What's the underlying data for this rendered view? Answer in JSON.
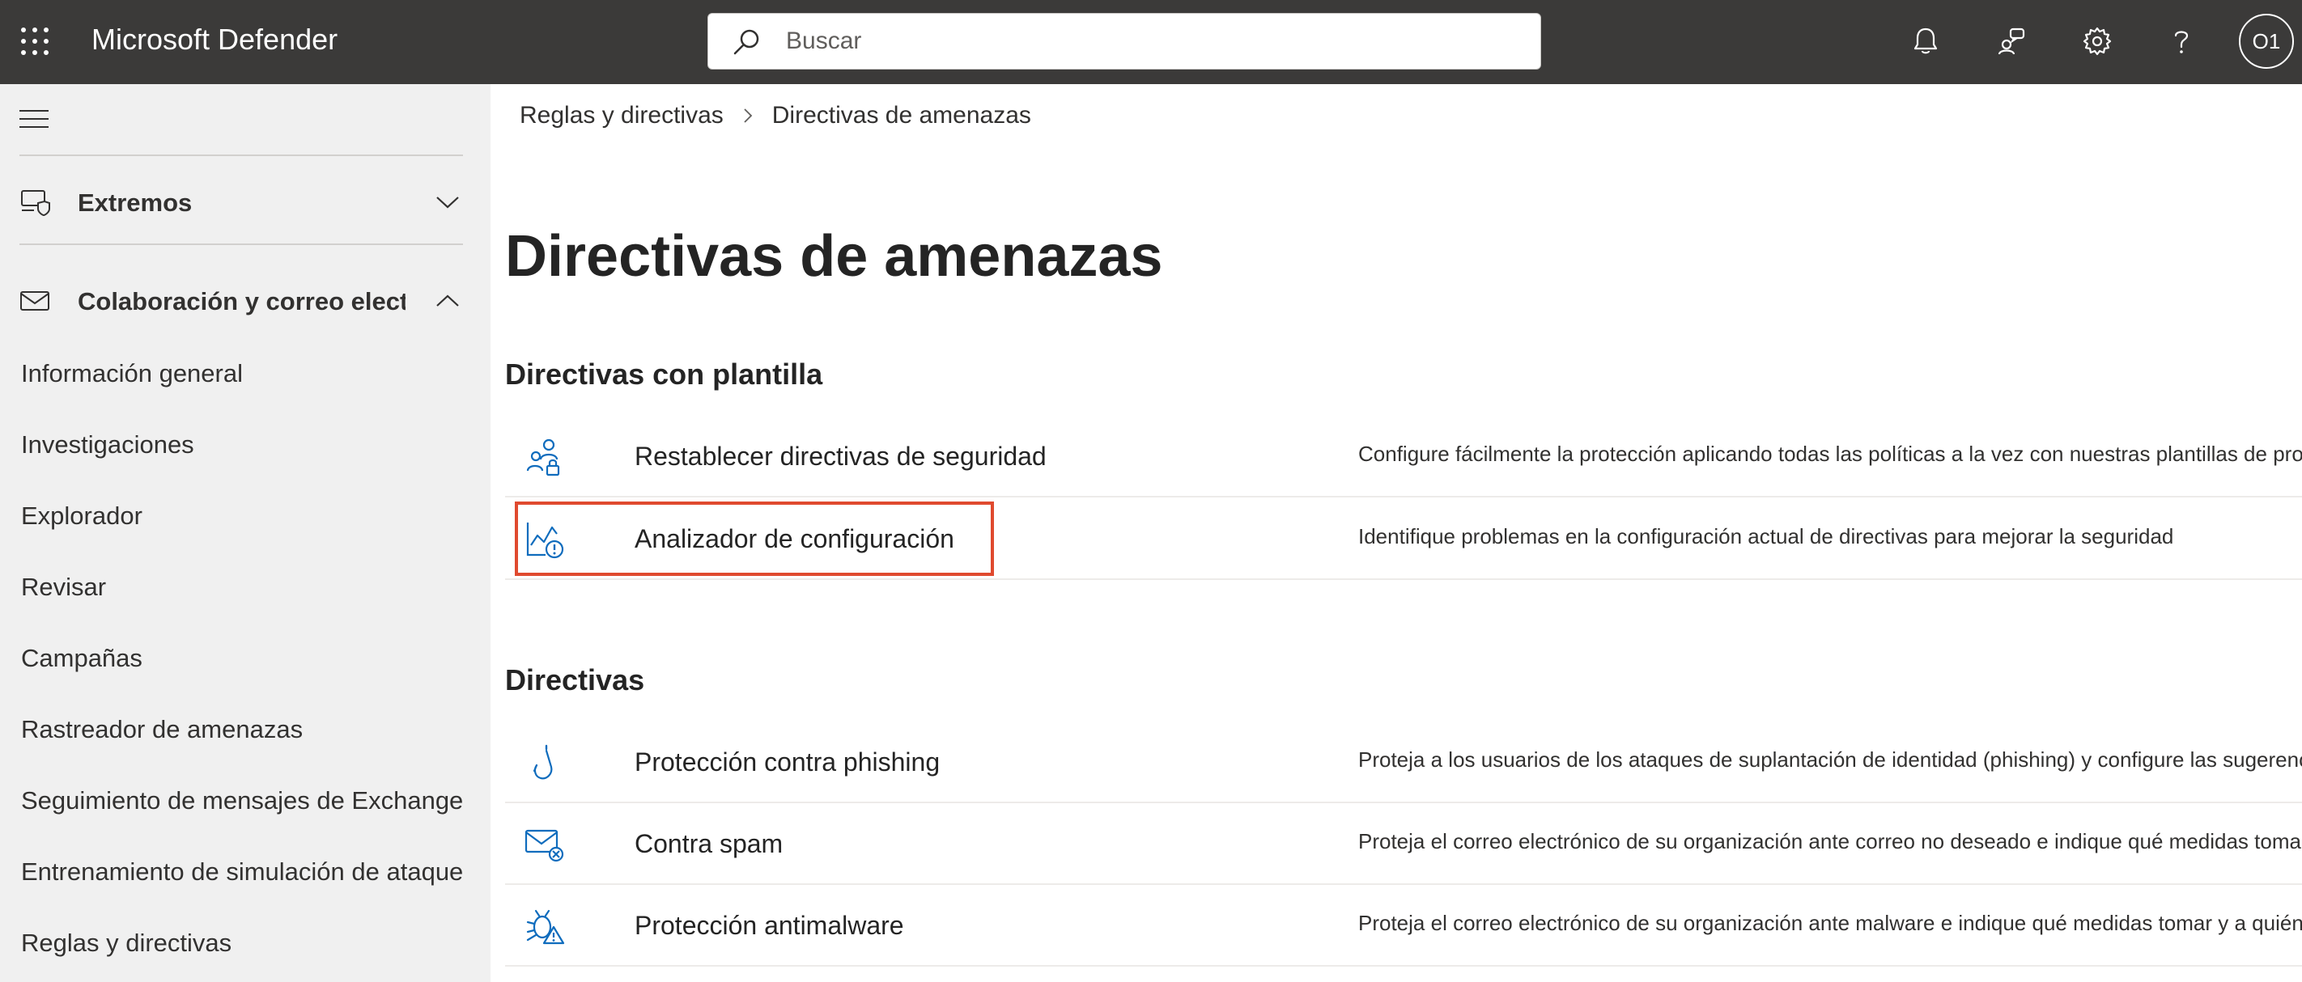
{
  "header": {
    "app_title": "Microsoft Defender",
    "search_placeholder": "Buscar",
    "avatar_initials": "O1",
    "icons": [
      "waffle-icon",
      "search-icon",
      "bell-icon",
      "community-icon",
      "gear-icon",
      "help-icon"
    ]
  },
  "sidebar": {
    "groups": [
      {
        "label": "Extremos",
        "icon": "endpoint-shield-icon",
        "expanded": false
      },
      {
        "label": "Colaboración y correo electrónico",
        "icon": "mail-icon",
        "expanded": true
      }
    ],
    "items": [
      {
        "label": "Información general"
      },
      {
        "label": "Investigaciones"
      },
      {
        "label": "Explorador"
      },
      {
        "label": "Revisar"
      },
      {
        "label": "Campañas"
      },
      {
        "label": "Rastreador de amenazas"
      },
      {
        "label": "Seguimiento de mensajes de Exchange"
      },
      {
        "label": "Entrenamiento de simulación de ataque"
      },
      {
        "label": "Reglas y directivas"
      }
    ]
  },
  "main": {
    "breadcrumb": [
      "Reglas y directivas",
      "Directivas de amenazas"
    ],
    "page_title": "Directivas de amenazas",
    "sections": [
      {
        "title": "Directivas con plantilla",
        "rows": [
          {
            "name": "Restablecer directivas de seguridad",
            "icon": "users-lock-icon",
            "description": "Configure fácilmente la protección aplicando todas las políticas a la vez con nuestras plantillas de protección"
          },
          {
            "name": "Analizador de configuración",
            "icon": "chart-alert-icon",
            "description": "Identifique problemas en la configuración actual de directivas para mejorar la seguridad",
            "highlighted": true
          }
        ]
      },
      {
        "title": "Directivas",
        "rows": [
          {
            "name": "Protección contra phishing",
            "icon": "fishhook-icon",
            "description": "Proteja a los usuarios de los ataques de suplantación de identidad (phishing) y configure las sugerencias de"
          },
          {
            "name": "Contra spam",
            "icon": "mail-blocked-icon",
            "description": "Proteja el correo electrónico de su organización ante correo no deseado e indique qué medidas tomar si se"
          },
          {
            "name": "Protección antimalware",
            "icon": "bug-warning-icon",
            "description": "Proteja el correo electrónico de su organización ante malware e indique qué medidas tomar y a quién avisar"
          }
        ]
      }
    ],
    "colors": {
      "highlight": "#e04a2f",
      "icon_blue": "#0f6cbd",
      "topbar": "#3b3a39",
      "sidebar": "#f0f0f0"
    }
  }
}
